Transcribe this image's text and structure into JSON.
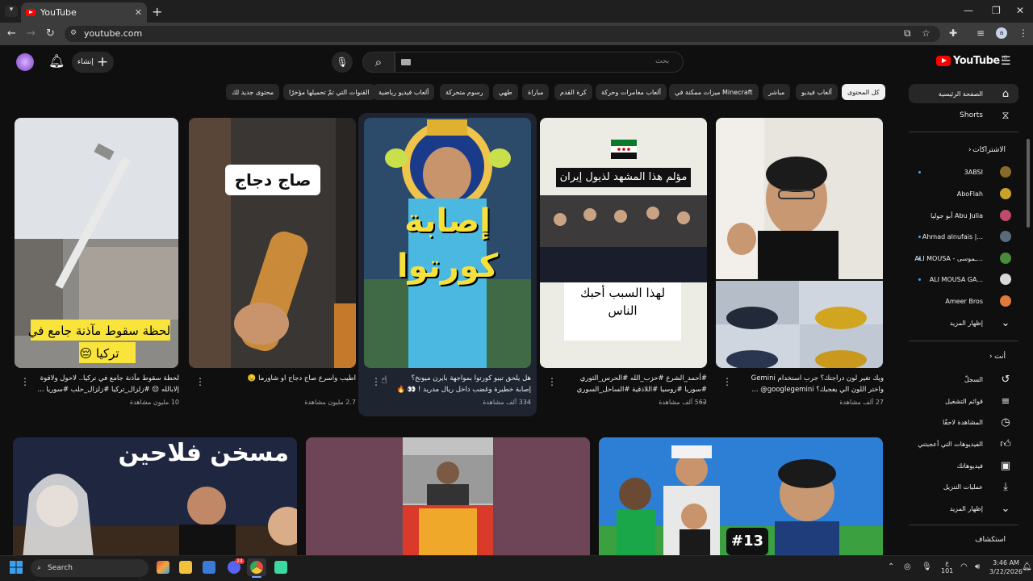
{
  "browser": {
    "tab_title": "YouTube",
    "url": "youtube.com",
    "profile_initial": "a",
    "new_tab": "+",
    "tab_close": "✕"
  },
  "header": {
    "logo_text": "YouTube",
    "region": "JO",
    "search_placeholder": "بحث",
    "create_label": "إنشاء"
  },
  "chips": [
    "كل المحتوى",
    "ألعاب فيديو",
    "مباشر",
    "ميزات ممكنة في Minecraft",
    "ألعاب مغامرات وحركة",
    "كرة القدم",
    "مباراة",
    "طهي",
    "رسوم متحركة",
    "ألعاب فيديو رياضية",
    "القنوات التي تمّ تحميلها مؤخرًا",
    "محتوى جديد لك"
  ],
  "sidebar": {
    "home": "الصفحة الرئيسية",
    "shorts": "Shorts",
    "subscriptions_title": "الاشتراكات",
    "channels": [
      {
        "name": "3ABSI",
        "dot": true,
        "color": "#8a6a2a"
      },
      {
        "name": "AboFlah",
        "dot": false,
        "color": "#c9a227"
      },
      {
        "name": "أبو جوليا Abu Julia",
        "dot": false,
        "color": "#c04a6a"
      },
      {
        "name": "Ahmad alnufais |...",
        "dot": true,
        "color": "#5a6a7a"
      },
      {
        "name": "ALI MOUSA - ـموسى...",
        "dot": true,
        "color": "#4a8a3a"
      },
      {
        "name": "ALI MOUSA GA...",
        "dot": true,
        "color": "#d8d8d8"
      },
      {
        "name": "Ameer Bros",
        "dot": false,
        "color": "#e07a3a"
      }
    ],
    "show_more": "إظهار المزيد",
    "you_title": "أنت",
    "you_items": [
      {
        "label": "السجلّ",
        "icon": "history-icon"
      },
      {
        "label": "قوائم التشغيل",
        "icon": "playlist-icon"
      },
      {
        "label": "المشاهدة لاحقًا",
        "icon": "clock-icon"
      },
      {
        "label": "الفيديوهات التي أعجبتني",
        "icon": "thumbs-up-icon"
      },
      {
        "label": "فيديوهاتك",
        "icon": "your-videos-icon"
      },
      {
        "label": "عمليات التنزيل",
        "icon": "download-icon"
      },
      {
        "label": "إظهار المزيد",
        "icon": "chevron-down-icon"
      }
    ],
    "explore_title": "استكشاف"
  },
  "videos": [
    {
      "overlay_top": "",
      "overlay_bottom": "",
      "title": "ويك تغير لون دراجتك؟ جرب استخدام Gemini واختر اللون الي يعجبك؟ googlegemini@ ...",
      "meta": "27 ألف مشاهدة"
    },
    {
      "overlay_top": "مؤلم هذا المشهد لذيول إيران",
      "overlay_bottom": "لهذا السبب أحبك الناس",
      "title": "#أحمد_الشرع #حزب_الله #الحرس_الثوري #سوريا #روسيا #اللاذقية #الساحل_السوري ...",
      "meta": "562 ألف مشاهدة"
    },
    {
      "overlay_top": "",
      "overlay_bottom": "إصابة كورتوا",
      "title": "هل يلحق تيبو كورتوا بمواجهة بايرن ميونخ؟ إصابة خطيرة وغضب داخل ريال مدريد ! 👀 🔥 ...",
      "meta": "334 ألف مشاهدة"
    },
    {
      "overlay_top": "صاج دجاج",
      "overlay_bottom": "",
      "title": "اطيب واسرع صاج دجاج او شاورما 🤤",
      "meta": "2.7 مليون مشاهدة"
    },
    {
      "overlay_top": "",
      "overlay_bottom": "لحظة سقوط مآذنة جامع في تركيا 😔",
      "title": "لحظة سقوط مآذنة جامع في تركيا.. لاحول ولاقوة إلابالله 😔 #زلزال_تركيا #زلزال_حلب #سوريا ...",
      "meta": "10 مليون مشاهدة"
    }
  ],
  "row2": [
    {
      "overlay": "#13"
    },
    {
      "overlay": ""
    },
    {
      "overlay": "مسخن فلاحين"
    }
  ],
  "taskbar": {
    "search_label": "Search",
    "discord_badge": "24",
    "clock_time": "3:46 AM",
    "clock_date": "3/22/2026",
    "lang": "ع",
    "lang_sub": "101"
  }
}
